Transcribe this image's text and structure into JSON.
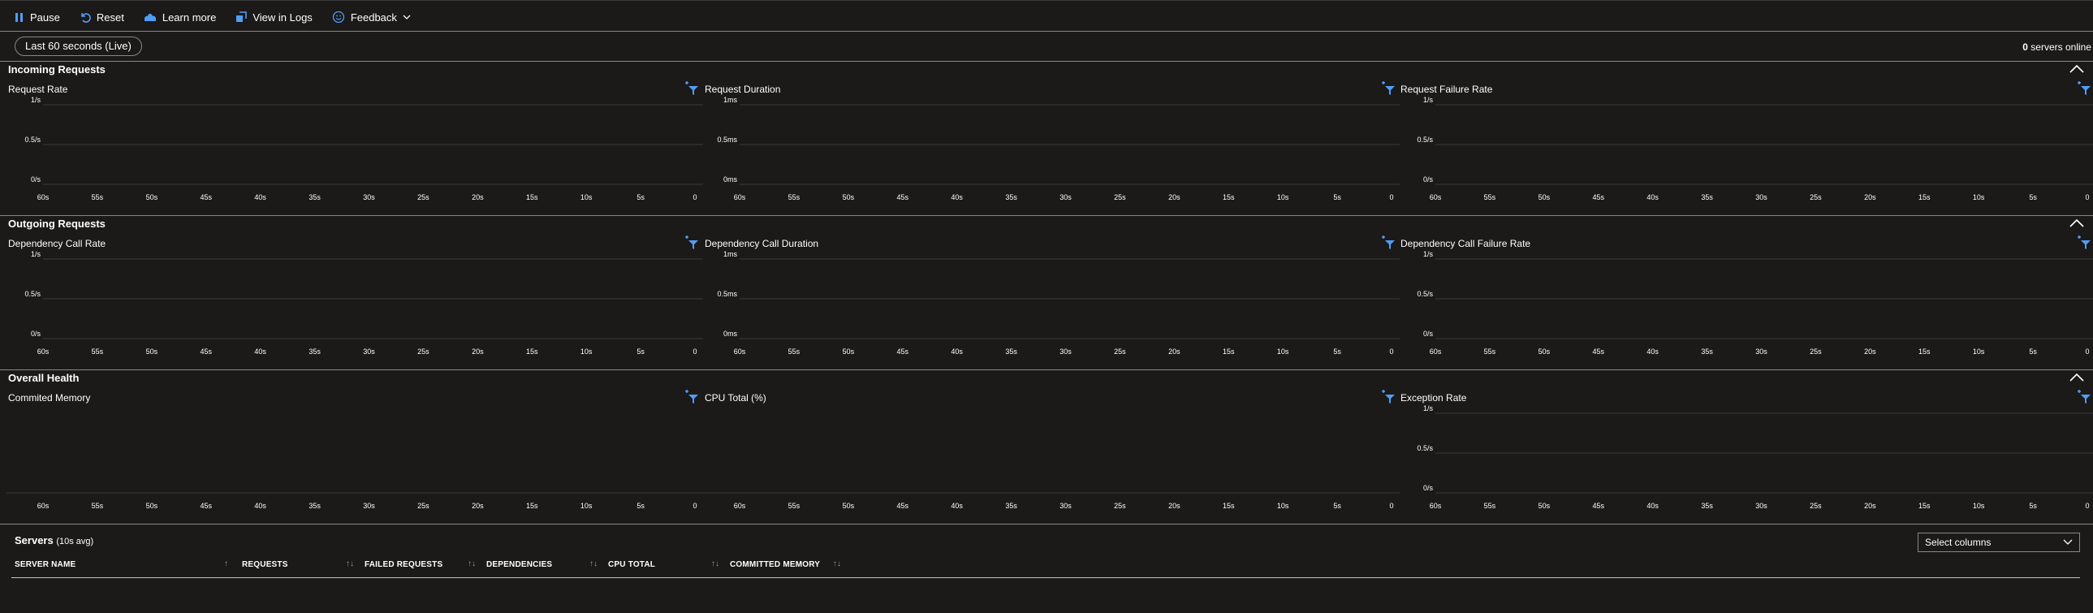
{
  "toolbar": {
    "pause": "Pause",
    "reset": "Reset",
    "learn_more": "Learn more",
    "view_in_logs": "View in Logs",
    "feedback": "Feedback"
  },
  "time_range": "Last 60 seconds (Live)",
  "servers_online": {
    "count": "0",
    "label": "servers online"
  },
  "x_ticks": [
    "60s",
    "55s",
    "50s",
    "45s",
    "40s",
    "35s",
    "30s",
    "25s",
    "20s",
    "15s",
    "10s",
    "5s",
    "0"
  ],
  "sections": [
    {
      "title": "Incoming Requests",
      "charts": [
        {
          "title": "Request Rate",
          "y_ticks": [
            "1/s",
            "0.5/s",
            "0/s"
          ]
        },
        {
          "title": "Request Duration",
          "y_ticks": [
            "1ms",
            "0.5ms",
            "0ms"
          ]
        },
        {
          "title": "Request Failure Rate",
          "y_ticks": [
            "1/s",
            "0.5/s",
            "0/s"
          ]
        }
      ]
    },
    {
      "title": "Outgoing Requests",
      "charts": [
        {
          "title": "Dependency Call Rate",
          "y_ticks": [
            "1/s",
            "0.5/s",
            "0/s"
          ]
        },
        {
          "title": "Dependency Call Duration",
          "y_ticks": [
            "1ms",
            "0.5ms",
            "0ms"
          ]
        },
        {
          "title": "Dependency Call Failure Rate",
          "y_ticks": [
            "1/s",
            "0.5/s",
            "0/s"
          ]
        }
      ]
    },
    {
      "title": "Overall Health",
      "charts": [
        {
          "title": "Commited Memory",
          "y_ticks": []
        },
        {
          "title": "CPU Total (%)",
          "y_ticks": []
        },
        {
          "title": "Exception Rate",
          "y_ticks": [
            "1/s",
            "0.5/s",
            "0/s"
          ]
        }
      ]
    }
  ],
  "servers": {
    "title": "Servers",
    "subtitle": "(10s avg)",
    "select_columns": "Select columns",
    "columns": [
      "SERVER NAME",
      "REQUESTS",
      "FAILED REQUESTS",
      "DEPENDENCIES",
      "CPU TOTAL",
      "COMMITTED MEMORY"
    ],
    "sort_glyph": "↑↓",
    "first_sort_glyph": "↑"
  },
  "colors": {
    "background": "#1b1a19",
    "accent": "#4f9ef8",
    "gridline": "#3b3a39"
  },
  "chart_data": [
    {
      "type": "line",
      "title": "Request Rate",
      "x": [
        "60s",
        "55s",
        "50s",
        "45s",
        "40s",
        "35s",
        "30s",
        "25s",
        "20s",
        "15s",
        "10s",
        "5s",
        "0"
      ],
      "ylim": [
        0,
        1
      ],
      "y_ticks": [
        "1/s",
        "0.5/s",
        "0/s"
      ],
      "series": []
    },
    {
      "type": "line",
      "title": "Request Duration",
      "ylim": [
        0,
        1
      ],
      "y_ticks": [
        "1ms",
        "0.5ms",
        "0ms"
      ],
      "series": []
    },
    {
      "type": "line",
      "title": "Request Failure Rate",
      "ylim": [
        0,
        1
      ],
      "y_ticks": [
        "1/s",
        "0.5/s",
        "0/s"
      ],
      "series": []
    },
    {
      "type": "line",
      "title": "Dependency Call Rate",
      "ylim": [
        0,
        1
      ],
      "y_ticks": [
        "1/s",
        "0.5/s",
        "0/s"
      ],
      "series": []
    },
    {
      "type": "line",
      "title": "Dependency Call Duration",
      "ylim": [
        0,
        1
      ],
      "y_ticks": [
        "1ms",
        "0.5ms",
        "0ms"
      ],
      "series": []
    },
    {
      "type": "line",
      "title": "Dependency Call Failure Rate",
      "ylim": [
        0,
        1
      ],
      "y_ticks": [
        "1/s",
        "0.5/s",
        "0/s"
      ],
      "series": []
    },
    {
      "type": "line",
      "title": "Commited Memory",
      "series": []
    },
    {
      "type": "line",
      "title": "CPU Total (%)",
      "series": []
    },
    {
      "type": "line",
      "title": "Exception Rate",
      "ylim": [
        0,
        1
      ],
      "y_ticks": [
        "1/s",
        "0.5/s",
        "0/s"
      ],
      "series": []
    }
  ]
}
